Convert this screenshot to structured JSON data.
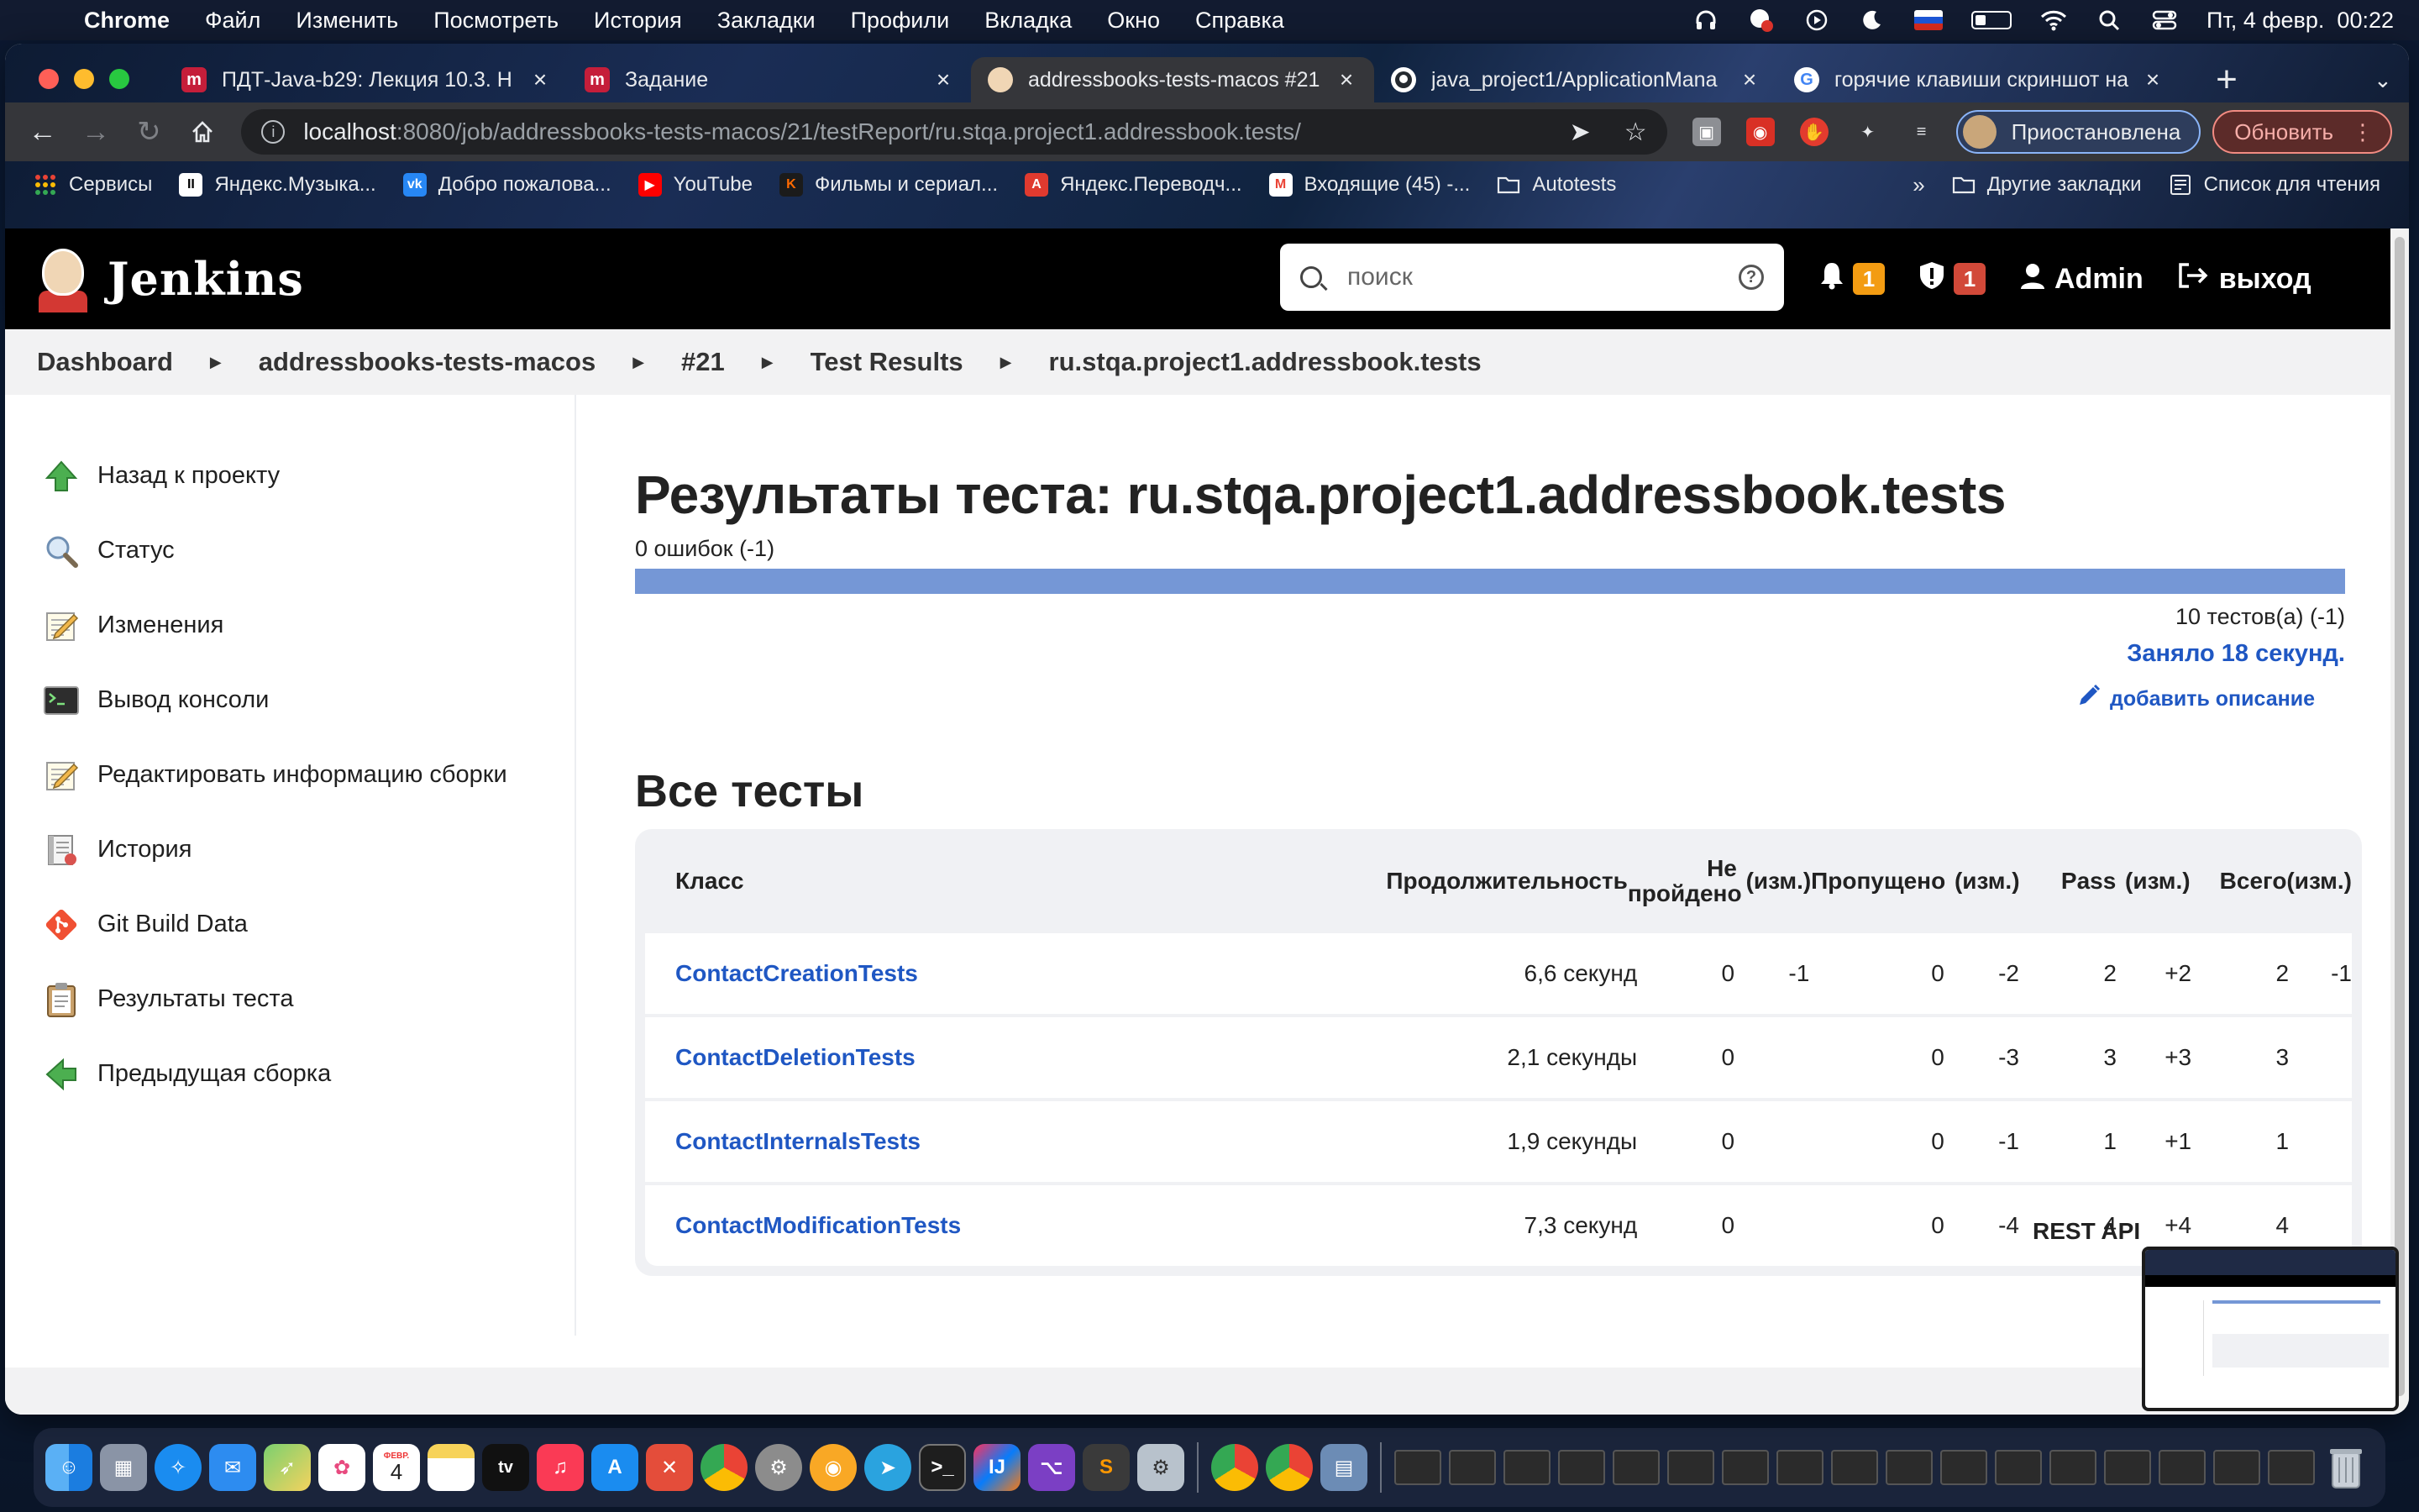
{
  "menubar": {
    "app": "Chrome",
    "items": [
      "Файл",
      "Изменить",
      "Посмотреть",
      "История",
      "Закладки",
      "Профили",
      "Вкладка",
      "Окно",
      "Справка"
    ],
    "datetime": "Пт, 4 февр.  00:22"
  },
  "tabs": [
    {
      "title": "ПДТ-Java-b29: Лекция 10.3. Н",
      "icon": "mailru-icon",
      "color": "#c51e3a"
    },
    {
      "title": "Задание",
      "icon": "mailru-icon",
      "color": "#c51e3a"
    },
    {
      "title": "addressbooks-tests-macos #21",
      "icon": "jenkins-icon",
      "color": "#d33833",
      "active": true
    },
    {
      "title": "java_project1/ApplicationMana",
      "icon": "github-icon",
      "color": "#24292f"
    },
    {
      "title": "горячие клавиши скриншот на",
      "icon": "google-icon",
      "color": "#4285f4"
    }
  ],
  "address": {
    "host": "localhost",
    "path": ":8080/job/addressbooks-tests-macos/21/testReport/ru.stqa.project1.addressbook.tests/"
  },
  "profile": {
    "label": "Приостановлена"
  },
  "update_button": "Обновить",
  "bookmarks": {
    "items": [
      {
        "label": "Сервисы",
        "color": "#ea4335"
      },
      {
        "label": "Яндекс.Музыка...",
        "color": "#000000"
      },
      {
        "label": "Добро пожалова...",
        "color": "#2787f5"
      },
      {
        "label": "YouTube",
        "color": "#ff0000"
      },
      {
        "label": "Фильмы и сериал...",
        "color": "#ff6a00"
      },
      {
        "label": "Яндекс.Переводч...",
        "color": "#e03a2f"
      },
      {
        "label": "Входящие (45) -...",
        "color": "#ea4335"
      },
      {
        "label": "Autotests",
        "color": "#e8eaed"
      }
    ],
    "more": "»",
    "other": "Другие закладки",
    "reading_list": "Список для чтения"
  },
  "jenkins": {
    "logo_text": "Jenkins",
    "search_placeholder": "поиск",
    "notifications_count": "1",
    "security_count": "1",
    "user": "Admin",
    "logout": "выход"
  },
  "breadcrumbs": [
    "Dashboard",
    "addressbooks-tests-macos",
    "#21",
    "Test Results",
    "ru.stqa.project1.addressbook.tests"
  ],
  "sidebar": [
    {
      "label": "Назад к проекту",
      "icon": "up-arrow-icon"
    },
    {
      "label": "Статус",
      "icon": "magnifier-icon"
    },
    {
      "label": "Изменения",
      "icon": "notepad-icon"
    },
    {
      "label": "Вывод консоли",
      "icon": "terminal-icon"
    },
    {
      "label": "Редактировать информацию сборки",
      "icon": "notepad-edit-icon"
    },
    {
      "label": "История",
      "icon": "history-icon"
    },
    {
      "label": "Git Build Data",
      "icon": "git-icon"
    },
    {
      "label": "Результаты теста",
      "icon": "clipboard-icon"
    },
    {
      "label": "Предыдущая сборка",
      "icon": "left-arrow-icon"
    }
  ],
  "report": {
    "title": "Результаты теста: ru.stqa.project1.addressbook.tests",
    "failures": "0 ошибок (-1)",
    "pass_fraction": 1.0,
    "tests": "10 тестов(а) (-1)",
    "took": "Заняло 18 секунд.",
    "add_description": "добавить описание"
  },
  "all_tests": {
    "heading": "Все тесты",
    "columns": {
      "class": "Класс",
      "duration": "Продолжительность",
      "failed": "Не пройдено",
      "failed_diff": "(изм.)",
      "skipped": "Пропущено",
      "skipped_diff": "(изм.)",
      "pass": "Pass",
      "pass_diff": "(изм.)",
      "total": "Всего",
      "total_diff": "(изм.)"
    },
    "rows": [
      {
        "class": "ContactCreationTests",
        "duration": "6,6 секунд",
        "failed": "0",
        "failed_diff": "-1",
        "skipped": "0",
        "skipped_diff": "-2",
        "pass": "2",
        "pass_diff": "+2",
        "total": "2",
        "total_diff": "-1"
      },
      {
        "class": "ContactDeletionTests",
        "duration": "2,1 секунды",
        "failed": "0",
        "failed_diff": "",
        "skipped": "0",
        "skipped_diff": "-3",
        "pass": "3",
        "pass_diff": "+3",
        "total": "3",
        "total_diff": ""
      },
      {
        "class": "ContactInternalsTests",
        "duration": "1,9 секунды",
        "failed": "0",
        "failed_diff": "",
        "skipped": "0",
        "skipped_diff": "-1",
        "pass": "1",
        "pass_diff": "+1",
        "total": "1",
        "total_diff": ""
      },
      {
        "class": "ContactModificationTests",
        "duration": "7,3 секунд",
        "failed": "0",
        "failed_diff": "",
        "skipped": "0",
        "skipped_diff": "-4",
        "pass": "4",
        "pass_diff": "+4",
        "total": "4",
        "total_diff": ""
      }
    ]
  },
  "footer": {
    "rest_api": "REST API"
  },
  "dock": {
    "calendar_month": "ФЕВР.",
    "calendar_day": "4",
    "tv_label": "tv"
  }
}
